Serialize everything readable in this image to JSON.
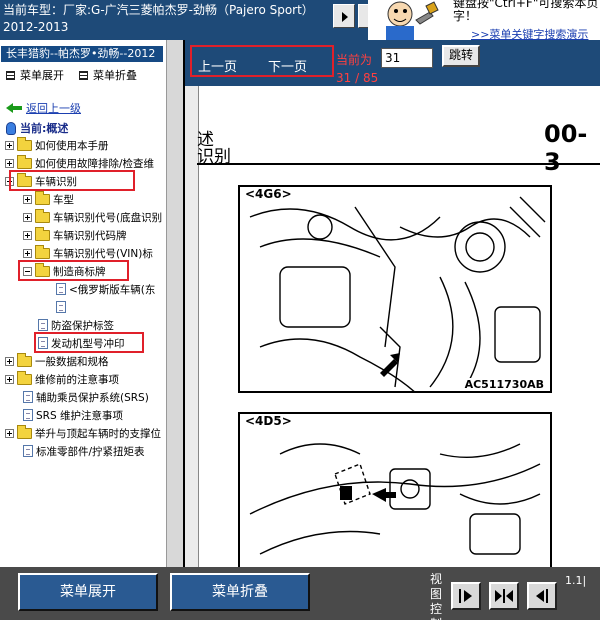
{
  "header": {
    "vehicle_title": "当前车型：厂家:G-广汽三菱帕杰罗-劲畅（Pajero Sport）2012-2013",
    "tip_text": "键盘按\"Ctrl+F\"可搜索本页\n字！",
    "tip_link": ">>菜单关键字搜索演示"
  },
  "sidebar": {
    "header": "长丰猎豹--帕杰罗•劲畅--2012",
    "expand_label": "菜单展开",
    "collapse_label": "菜单折叠",
    "back_label": "返回上一级",
    "current_label": "当前:概述",
    "items": [
      {
        "label": "如何使用本手册"
      },
      {
        "label": "如何使用故障排除/检查维"
      },
      {
        "label": "车辆识别"
      },
      {
        "label": "车型"
      },
      {
        "label": "车辆识别代号(底盘识别"
      },
      {
        "label": "车辆识别代码牌"
      },
      {
        "label": "车辆识别代号(VIN)标"
      },
      {
        "label": "制造商标牌"
      },
      {
        "label": "<俄罗斯版车辆(东"
      },
      {
        "label": ""
      },
      {
        "label": "防盗保护标签"
      },
      {
        "label": "发动机型号冲印"
      },
      {
        "label": "一般数据和规格"
      },
      {
        "label": "维修前的注意事项"
      },
      {
        "label": "辅助乘员保护系统(SRS)"
      },
      {
        "label": "SRS 维护注意事项"
      },
      {
        "label": "举升与顶起车辆时的支撑位"
      },
      {
        "label": "标准零部件/拧紧扭矩表"
      }
    ]
  },
  "toolbar": {
    "prev_label": "上一页",
    "next_label": "下一页",
    "page_prefix": "当前为",
    "page_input": "31",
    "page_counter": "31 / 85",
    "jump_label": "跳转"
  },
  "document": {
    "heading_frag1": "述",
    "heading_frag2": "识别",
    "section_code": "00-3",
    "figures": [
      {
        "label": "<4G6>",
        "id": "AC511730AB"
      },
      {
        "label": "<4D5>",
        "id": ""
      }
    ]
  },
  "bottom": {
    "expand_label": "菜单展开",
    "collapse_label": "菜单折叠",
    "view_control_label": "视图控制",
    "zoom_label": "1.1|"
  },
  "colors": {
    "title_bar": "#1e4a78",
    "highlight_red": "#e0202a",
    "page_counter_red": "#ff4040",
    "folder_yellow": "#f3d33e"
  }
}
